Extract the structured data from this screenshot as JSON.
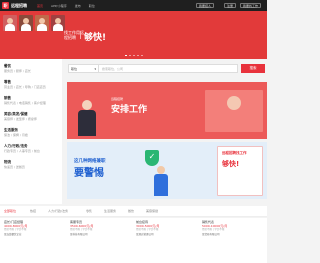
{
  "brand": {
    "logo_mark": "职",
    "name": "远程招聘"
  },
  "nav": {
    "links": [
      "首页",
      "APP/小程序",
      "发布",
      "职位"
    ],
    "register_button": "我要招人",
    "login_button": "注册",
    "jobseeker_button": "我要找工作"
  },
  "hero": {
    "slogan_small": "找工作用远程招聘",
    "slogan_big": "够快!",
    "dots": 5
  },
  "sidebar": {
    "categories": [
      {
        "title": "餐饮",
        "sub": "服务员 / 厨师 / 店长"
      },
      {
        "title": "零售",
        "sub": "营业员 / 店长 / 导购 / 门店店员"
      },
      {
        "title": "销售",
        "sub": "销售代表 / 电话销售 / 客户经理"
      },
      {
        "title": "美容/美发/保健",
        "sub": "美容师 / 发型师 / 按摩师"
      },
      {
        "title": "生活服务",
        "sub": "保洁 / 保姆 / 月嫂"
      },
      {
        "title": "人力/行政/法务",
        "sub": "行政专员 / 人事专员 / 前台"
      },
      {
        "title": "物流",
        "sub": "快递员 / 送餐员"
      }
    ]
  },
  "search": {
    "type_label": "职位",
    "placeholder": "搜索职位、公司",
    "button": "搜索"
  },
  "banner1": {
    "logo_text": "远程招聘",
    "title": "安排工作"
  },
  "banner2": {
    "subtitle": "这几种网络兼职",
    "title": "要警惕",
    "card_small": "远程招聘找工作",
    "card_big": "够快!"
  },
  "tabs": [
    "全部职位",
    "热招",
    "人力/行政/法务",
    "零售",
    "生活服务",
    "餐饮",
    "美容保健"
  ],
  "jobs": [
    {
      "title": "店长/门店经理",
      "salary": "4000-8000元/月",
      "meta": "经验不限 | 学历不限",
      "company": "某连锁餐饮企业"
    },
    {
      "title": "客服专员",
      "salary": "3500-6000元/月",
      "meta": "经验不限 | 学历不限",
      "company": "某科技有限公司"
    },
    {
      "title": "前台接待",
      "salary": "3000-5000元/月",
      "meta": "经验不限 | 学历不限",
      "company": "某酒店管理公司"
    },
    {
      "title": "销售代表",
      "salary": "5000-10000元/月",
      "meta": "经验不限 | 学历不限",
      "company": "某贸易有限公司"
    }
  ]
}
